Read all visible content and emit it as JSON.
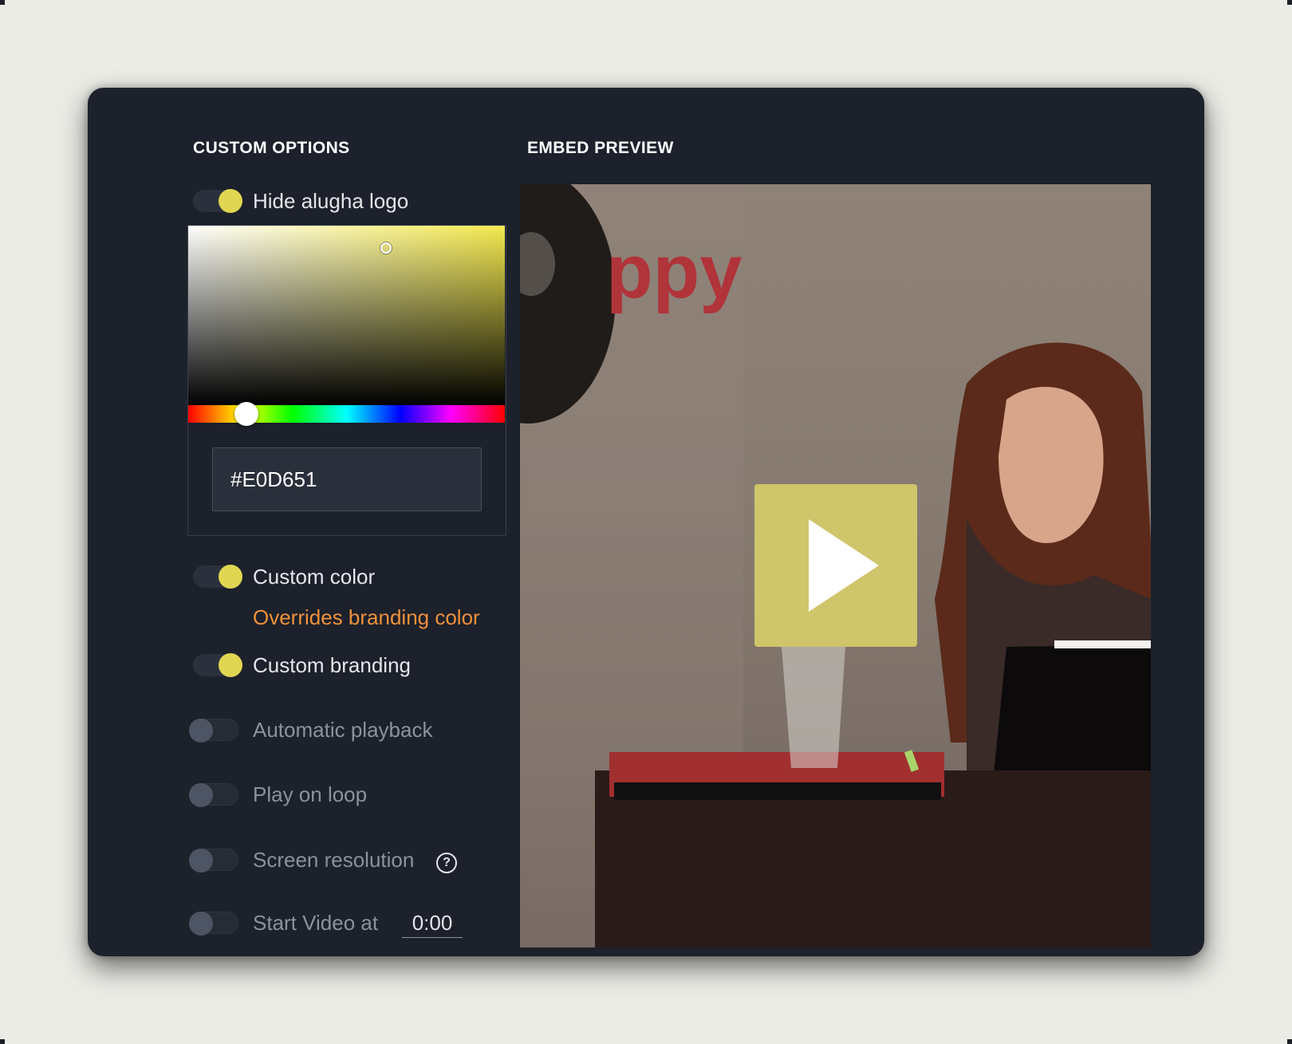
{
  "sections": {
    "options_title": "CUSTOM OPTIONS",
    "preview_title": "EMBED PREVIEW"
  },
  "options": {
    "hide_logo": {
      "label": "Hide alugha logo",
      "enabled": true
    },
    "custom_color": {
      "label": "Custom color",
      "enabled": true,
      "note": "Overrides branding color"
    },
    "custom_branding": {
      "label": "Custom branding",
      "enabled": true
    },
    "autoplay": {
      "label": "Automatic playback",
      "enabled": false
    },
    "loop": {
      "label": "Play on loop",
      "enabled": false
    },
    "resolution": {
      "label": "Screen resolution",
      "enabled": false,
      "help_glyph": "?"
    },
    "start_time": {
      "label": "Start Video at",
      "enabled": false,
      "value": "0:00"
    }
  },
  "color_picker": {
    "hex_value": "#E0D651",
    "hue_color": "#f4e94f"
  },
  "preview": {
    "sign_text": "ppy",
    "play_button_color": "#cfc56a"
  },
  "colors": {
    "accent": "#E0D651",
    "note": "#f0913b",
    "panel_bg": "#1c212b"
  }
}
